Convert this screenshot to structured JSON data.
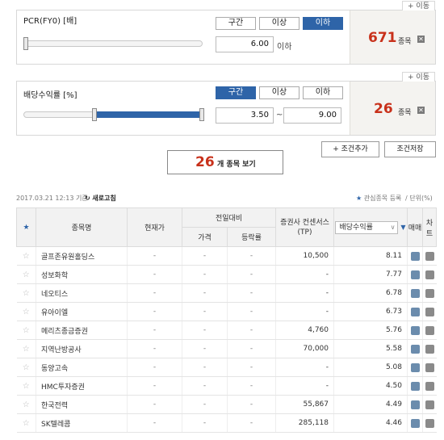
{
  "filters": [
    {
      "move_label": "+ 이동",
      "title": "PCR(FY0) [배]",
      "modes": [
        "구간",
        "이상",
        "이하"
      ],
      "active_mode": 2,
      "slider_range": [
        0.0,
        1.0
      ],
      "slider_fill": [
        0.0,
        0.0
      ],
      "value_1": "6.00",
      "unit_label": "이하",
      "count": "671",
      "count_label": "종목",
      "remove_label": "✕"
    },
    {
      "move_label": "+ 이동",
      "title": "배당수익률 [%]",
      "modes": [
        "구간",
        "이상",
        "이하"
      ],
      "active_mode": 0,
      "slider_range": [
        0.0,
        1.0
      ],
      "slider_fill": [
        0.39,
        1.0
      ],
      "value_1": "3.50",
      "separator": "~",
      "value_2": "9.00",
      "count": "26",
      "count_label": "종목",
      "remove_label": "✕"
    }
  ],
  "actions": {
    "add_condition": "+ 조건추가",
    "save_condition": "조건저장"
  },
  "view_button": {
    "count": "26",
    "label": "개 종목 보기"
  },
  "meta": {
    "timestamp": "2017.03.21 12:13 기준",
    "refresh": "새로고침",
    "interest": "관심종목 등록",
    "unit": "/ 단위(%)"
  },
  "table": {
    "headers": {
      "name": "종목명",
      "price": "현재가",
      "prev_group": "전일대비",
      "prev_price": "가격",
      "prev_rate": "등락률",
      "consensus": "증권사 컨센서스(TP)",
      "dividend_select": "배당수익률",
      "trade": "매매",
      "chart": "차트"
    },
    "rows": [
      {
        "name": "골프존유원홀딩스",
        "price": "-",
        "prev_price": "-",
        "prev_rate": "-",
        "consensus": "10,500",
        "dividend": "8.11"
      },
      {
        "name": "성보화학",
        "price": "-",
        "prev_price": "-",
        "prev_rate": "-",
        "consensus": "-",
        "dividend": "7.77"
      },
      {
        "name": "네오티스",
        "price": "-",
        "prev_price": "-",
        "prev_rate": "-",
        "consensus": "-",
        "dividend": "6.78"
      },
      {
        "name": "유아이엘",
        "price": "-",
        "prev_price": "-",
        "prev_rate": "-",
        "consensus": "-",
        "dividend": "6.73"
      },
      {
        "name": "메리츠종금증권",
        "price": "-",
        "prev_price": "-",
        "prev_rate": "-",
        "consensus": "4,760",
        "dividend": "5.76"
      },
      {
        "name": "지역난방공사",
        "price": "-",
        "prev_price": "-",
        "prev_rate": "-",
        "consensus": "70,000",
        "dividend": "5.58"
      },
      {
        "name": "동양고속",
        "price": "-",
        "prev_price": "-",
        "prev_rate": "-",
        "consensus": "-",
        "dividend": "5.08"
      },
      {
        "name": "HMC투자증권",
        "price": "-",
        "prev_price": "-",
        "prev_rate": "-",
        "consensus": "-",
        "dividend": "4.50"
      },
      {
        "name": "한국전력",
        "price": "-",
        "prev_price": "-",
        "prev_rate": "-",
        "consensus": "55,867",
        "dividend": "4.49"
      },
      {
        "name": "SK텔레콤",
        "price": "-",
        "prev_price": "-",
        "prev_rate": "-",
        "consensus": "285,118",
        "dividend": "4.46"
      }
    ]
  }
}
